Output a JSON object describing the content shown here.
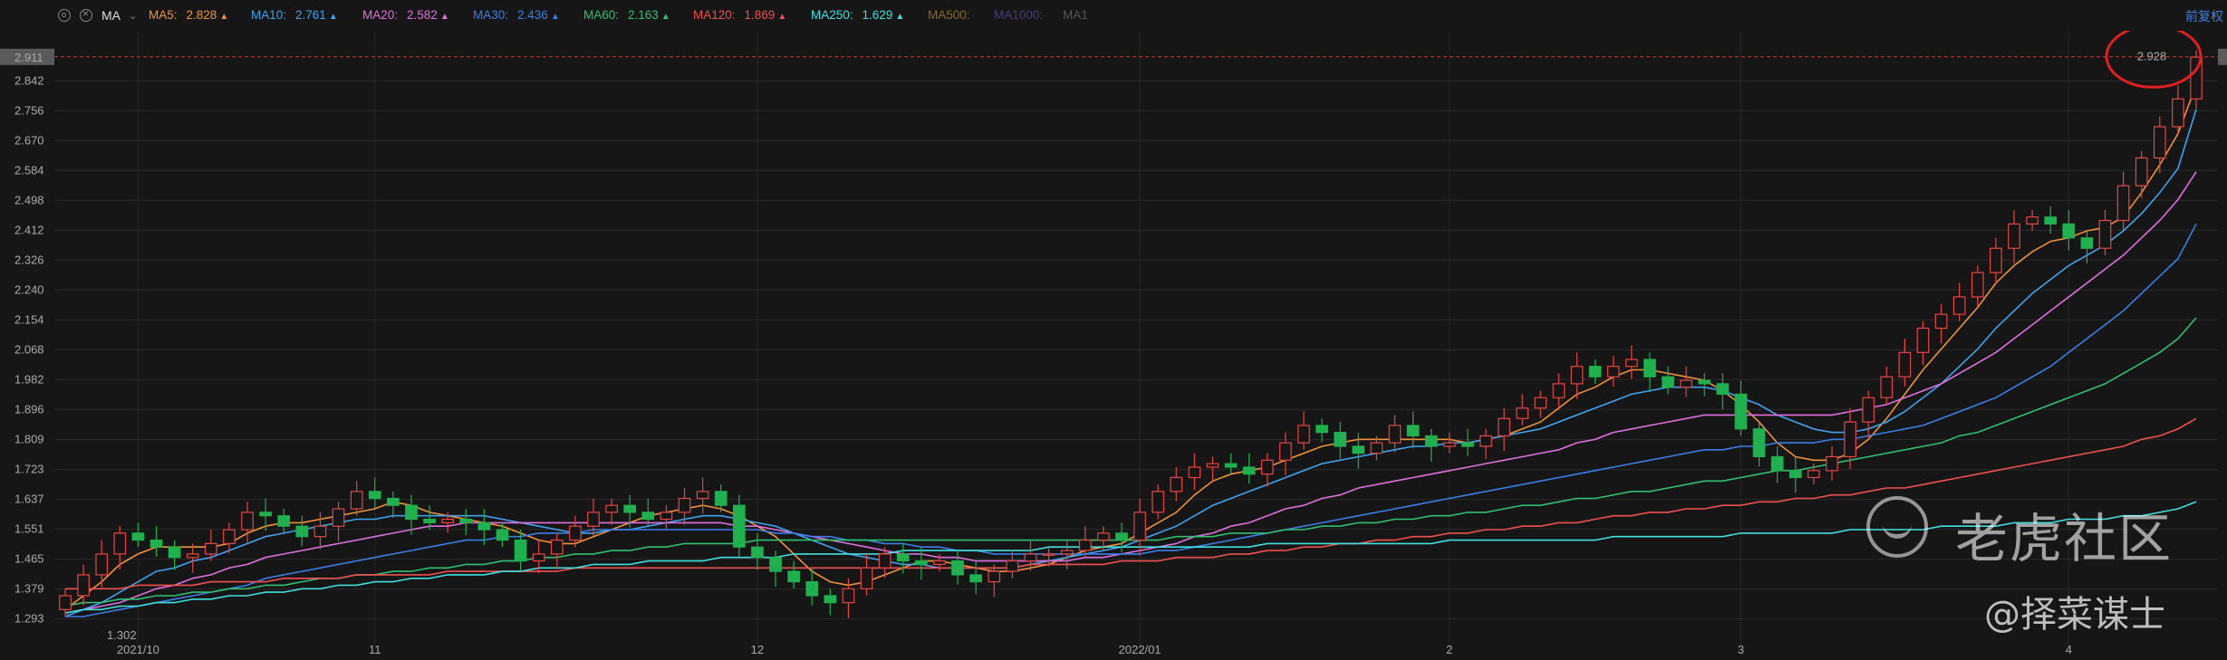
{
  "toolbar": {
    "indicator_label": "MA",
    "settings_icon": "gear-icon",
    "close_icon": "close-icon",
    "dropdown_icon": "chevron-down-icon",
    "adjust_label": "前复权"
  },
  "ma_legend": [
    {
      "label": "MA5:",
      "value": "2.828",
      "color": "#f0923a",
      "arrow": "▲"
    },
    {
      "label": "MA10:",
      "value": "2.761",
      "color": "#3fa3f0",
      "arrow": "▲"
    },
    {
      "label": "MA20:",
      "value": "2.582",
      "color": "#e070e0",
      "arrow": "▲"
    },
    {
      "label": "MA30:",
      "value": "2.436",
      "color": "#3a7fe8",
      "arrow": "▲"
    },
    {
      "label": "MA60:",
      "value": "2.163",
      "color": "#30c070",
      "arrow": "▲"
    },
    {
      "label": "MA120:",
      "value": "1.869",
      "color": "#f05050",
      "arrow": "▲"
    },
    {
      "label": "MA250:",
      "value": "1.629",
      "color": "#40e0e0",
      "arrow": "▲"
    },
    {
      "label": "MA500:",
      "value": "",
      "color": "#8a6a20",
      "arrow": ""
    },
    {
      "label": "MA1000:",
      "value": "",
      "color": "#4a3a7a",
      "arrow": ""
    },
    {
      "label": "MA1",
      "value": "",
      "color": "#555555",
      "arrow": ""
    }
  ],
  "watermark": {
    "brand_text": "老虎社区",
    "author_text": "@择菜谋士",
    "logo_icon": "tiger-logo-icon"
  },
  "chart_data": {
    "type": "candlestick",
    "y_ticks": [
      "2.842",
      "2.756",
      "2.670",
      "2.584",
      "2.498",
      "2.412",
      "2.326",
      "2.240",
      "2.154",
      "2.068",
      "1.982",
      "1.896",
      "1.809",
      "1.723",
      "1.637",
      "1.551",
      "1.465",
      "1.379",
      "1.293"
    ],
    "ylim": [
      1.24,
      2.96
    ],
    "x_labels": [
      {
        "label": "2021/10",
        "index": 4
      },
      {
        "label": "11",
        "index": 17
      },
      {
        "label": "12",
        "index": 38
      },
      {
        "label": "2022/01",
        "index": 59
      },
      {
        "label": "2",
        "index": 76
      },
      {
        "label": "3",
        "index": 92
      },
      {
        "label": "4",
        "index": 110
      }
    ],
    "current_price": "2.911",
    "high_label": "2.928",
    "low_label": "1.302",
    "candle_count": 118,
    "up_color": "#e84545",
    "down_color": "#1fb14e",
    "closes": [
      1.36,
      1.42,
      1.48,
      1.54,
      1.52,
      1.5,
      1.47,
      1.48,
      1.51,
      1.55,
      1.6,
      1.59,
      1.56,
      1.53,
      1.56,
      1.61,
      1.66,
      1.64,
      1.62,
      1.58,
      1.57,
      1.58,
      1.57,
      1.55,
      1.52,
      1.46,
      1.48,
      1.52,
      1.56,
      1.6,
      1.62,
      1.6,
      1.58,
      1.6,
      1.64,
      1.66,
      1.62,
      1.5,
      1.47,
      1.43,
      1.4,
      1.36,
      1.34,
      1.38,
      1.44,
      1.48,
      1.46,
      1.45,
      1.46,
      1.42,
      1.4,
      1.43,
      1.46,
      1.48,
      1.48,
      1.49,
      1.52,
      1.54,
      1.52,
      1.6,
      1.66,
      1.7,
      1.73,
      1.74,
      1.73,
      1.71,
      1.75,
      1.8,
      1.85,
      1.83,
      1.79,
      1.77,
      1.8,
      1.85,
      1.82,
      1.79,
      1.8,
      1.79,
      1.82,
      1.87,
      1.9,
      1.93,
      1.97,
      2.02,
      1.99,
      2.02,
      2.04,
      1.99,
      1.96,
      1.98,
      1.97,
      1.94,
      1.84,
      1.76,
      1.72,
      1.7,
      1.72,
      1.76,
      1.86,
      1.93,
      1.99,
      2.06,
      2.13,
      2.17,
      2.22,
      2.29,
      2.36,
      2.43,
      2.45,
      2.43,
      2.39,
      2.36,
      2.44,
      2.54,
      2.62,
      2.71,
      2.79,
      2.91
    ],
    "ma_series": {
      "MA5": [
        1.32,
        1.36,
        1.4,
        1.45,
        1.48,
        1.5,
        1.5,
        1.5,
        1.5,
        1.51,
        1.54,
        1.56,
        1.57,
        1.57,
        1.58,
        1.59,
        1.6,
        1.61,
        1.63,
        1.62,
        1.6,
        1.59,
        1.58,
        1.57,
        1.56,
        1.54,
        1.52,
        1.51,
        1.51,
        1.53,
        1.55,
        1.57,
        1.59,
        1.6,
        1.61,
        1.62,
        1.61,
        1.59,
        1.56,
        1.53,
        1.48,
        1.43,
        1.4,
        1.39,
        1.4,
        1.42,
        1.44,
        1.46,
        1.46,
        1.45,
        1.44,
        1.43,
        1.43,
        1.44,
        1.45,
        1.47,
        1.49,
        1.5,
        1.51,
        1.54,
        1.57,
        1.6,
        1.65,
        1.69,
        1.71,
        1.72,
        1.73,
        1.75,
        1.77,
        1.79,
        1.8,
        1.81,
        1.81,
        1.81,
        1.81,
        1.81,
        1.81,
        1.8,
        1.81,
        1.82,
        1.84,
        1.86,
        1.9,
        1.94,
        1.96,
        1.99,
        2.01,
        2.01,
        2.0,
        1.99,
        1.98,
        1.95,
        1.91,
        1.86,
        1.8,
        1.76,
        1.75,
        1.75,
        1.77,
        1.81,
        1.87,
        1.94,
        2.01,
        2.07,
        2.13,
        2.19,
        2.26,
        2.31,
        2.35,
        2.38,
        2.39,
        2.41,
        2.42,
        2.45,
        2.52,
        2.6,
        2.69,
        2.83
      ],
      "MA10": [
        1.3,
        1.32,
        1.34,
        1.37,
        1.4,
        1.43,
        1.44,
        1.46,
        1.47,
        1.49,
        1.51,
        1.53,
        1.54,
        1.55,
        1.56,
        1.57,
        1.58,
        1.58,
        1.59,
        1.59,
        1.59,
        1.59,
        1.59,
        1.59,
        1.58,
        1.57,
        1.56,
        1.55,
        1.54,
        1.54,
        1.55,
        1.55,
        1.56,
        1.57,
        1.58,
        1.59,
        1.59,
        1.58,
        1.57,
        1.56,
        1.54,
        1.52,
        1.5,
        1.48,
        1.47,
        1.46,
        1.45,
        1.45,
        1.44,
        1.44,
        1.44,
        1.44,
        1.44,
        1.45,
        1.46,
        1.47,
        1.48,
        1.49,
        1.5,
        1.52,
        1.54,
        1.56,
        1.59,
        1.62,
        1.64,
        1.66,
        1.68,
        1.7,
        1.72,
        1.74,
        1.75,
        1.76,
        1.77,
        1.78,
        1.79,
        1.79,
        1.8,
        1.8,
        1.81,
        1.82,
        1.83,
        1.84,
        1.86,
        1.88,
        1.9,
        1.92,
        1.94,
        1.95,
        1.96,
        1.96,
        1.96,
        1.95,
        1.93,
        1.91,
        1.88,
        1.86,
        1.84,
        1.83,
        1.83,
        1.84,
        1.86,
        1.89,
        1.93,
        1.97,
        2.02,
        2.07,
        2.13,
        2.18,
        2.23,
        2.27,
        2.31,
        2.34,
        2.37,
        2.41,
        2.46,
        2.52,
        2.59,
        2.76
      ],
      "MA20": [
        1.31,
        1.32,
        1.33,
        1.34,
        1.36,
        1.38,
        1.39,
        1.41,
        1.42,
        1.44,
        1.45,
        1.47,
        1.48,
        1.49,
        1.5,
        1.51,
        1.52,
        1.53,
        1.54,
        1.55,
        1.56,
        1.56,
        1.57,
        1.57,
        1.57,
        1.57,
        1.57,
        1.57,
        1.57,
        1.57,
        1.57,
        1.57,
        1.57,
        1.57,
        1.57,
        1.57,
        1.57,
        1.56,
        1.56,
        1.55,
        1.54,
        1.53,
        1.52,
        1.51,
        1.5,
        1.49,
        1.48,
        1.48,
        1.47,
        1.47,
        1.46,
        1.46,
        1.46,
        1.46,
        1.46,
        1.46,
        1.47,
        1.47,
        1.48,
        1.49,
        1.5,
        1.51,
        1.53,
        1.54,
        1.56,
        1.57,
        1.59,
        1.61,
        1.62,
        1.64,
        1.65,
        1.67,
        1.68,
        1.69,
        1.7,
        1.71,
        1.72,
        1.73,
        1.74,
        1.75,
        1.76,
        1.77,
        1.78,
        1.8,
        1.81,
        1.83,
        1.84,
        1.85,
        1.86,
        1.87,
        1.88,
        1.88,
        1.88,
        1.88,
        1.88,
        1.88,
        1.88,
        1.88,
        1.89,
        1.9,
        1.91,
        1.93,
        1.95,
        1.97,
        2.0,
        2.03,
        2.06,
        2.1,
        2.14,
        2.18,
        2.22,
        2.26,
        2.3,
        2.34,
        2.39,
        2.44,
        2.5,
        2.58
      ],
      "MA30": [
        1.3,
        1.3,
        1.31,
        1.32,
        1.33,
        1.34,
        1.35,
        1.36,
        1.37,
        1.38,
        1.39,
        1.41,
        1.42,
        1.43,
        1.44,
        1.45,
        1.46,
        1.47,
        1.48,
        1.49,
        1.5,
        1.51,
        1.52,
        1.52,
        1.53,
        1.53,
        1.54,
        1.54,
        1.54,
        1.55,
        1.55,
        1.55,
        1.55,
        1.55,
        1.55,
        1.55,
        1.55,
        1.55,
        1.55,
        1.54,
        1.54,
        1.53,
        1.53,
        1.52,
        1.52,
        1.51,
        1.51,
        1.5,
        1.5,
        1.49,
        1.49,
        1.48,
        1.48,
        1.48,
        1.48,
        1.48,
        1.48,
        1.48,
        1.48,
        1.48,
        1.49,
        1.49,
        1.5,
        1.51,
        1.52,
        1.53,
        1.54,
        1.55,
        1.56,
        1.57,
        1.58,
        1.59,
        1.6,
        1.61,
        1.62,
        1.63,
        1.64,
        1.65,
        1.66,
        1.67,
        1.68,
        1.69,
        1.7,
        1.71,
        1.72,
        1.73,
        1.74,
        1.75,
        1.76,
        1.77,
        1.78,
        1.78,
        1.79,
        1.79,
        1.8,
        1.8,
        1.8,
        1.81,
        1.81,
        1.82,
        1.83,
        1.84,
        1.85,
        1.87,
        1.89,
        1.91,
        1.93,
        1.96,
        1.99,
        2.02,
        2.06,
        2.1,
        2.14,
        2.18,
        2.23,
        2.28,
        2.33,
        2.43
      ],
      "MA60": [
        1.33,
        1.34,
        1.34,
        1.35,
        1.35,
        1.36,
        1.36,
        1.37,
        1.37,
        1.38,
        1.38,
        1.39,
        1.39,
        1.4,
        1.41,
        1.41,
        1.42,
        1.42,
        1.43,
        1.43,
        1.44,
        1.44,
        1.45,
        1.45,
        1.46,
        1.46,
        1.47,
        1.47,
        1.48,
        1.48,
        1.49,
        1.49,
        1.5,
        1.5,
        1.51,
        1.51,
        1.51,
        1.51,
        1.52,
        1.52,
        1.52,
        1.52,
        1.52,
        1.52,
        1.52,
        1.52,
        1.52,
        1.52,
        1.52,
        1.52,
        1.52,
        1.52,
        1.52,
        1.52,
        1.52,
        1.52,
        1.52,
        1.52,
        1.52,
        1.52,
        1.52,
        1.53,
        1.53,
        1.53,
        1.54,
        1.54,
        1.54,
        1.55,
        1.55,
        1.56,
        1.56,
        1.57,
        1.57,
        1.58,
        1.58,
        1.59,
        1.59,
        1.6,
        1.6,
        1.61,
        1.62,
        1.62,
        1.63,
        1.64,
        1.64,
        1.65,
        1.66,
        1.66,
        1.67,
        1.68,
        1.69,
        1.69,
        1.7,
        1.71,
        1.72,
        1.72,
        1.73,
        1.74,
        1.75,
        1.76,
        1.77,
        1.78,
        1.79,
        1.8,
        1.82,
        1.83,
        1.85,
        1.87,
        1.89,
        1.91,
        1.93,
        1.95,
        1.97,
        2.0,
        2.03,
        2.06,
        2.1,
        2.16
      ],
      "MA120": [
        1.38,
        1.38,
        1.38,
        1.38,
        1.39,
        1.39,
        1.39,
        1.39,
        1.4,
        1.4,
        1.4,
        1.4,
        1.41,
        1.41,
        1.41,
        1.41,
        1.42,
        1.42,
        1.42,
        1.42,
        1.42,
        1.43,
        1.43,
        1.43,
        1.43,
        1.43,
        1.43,
        1.43,
        1.44,
        1.44,
        1.44,
        1.44,
        1.44,
        1.44,
        1.44,
        1.44,
        1.44,
        1.44,
        1.44,
        1.44,
        1.44,
        1.44,
        1.44,
        1.44,
        1.44,
        1.44,
        1.44,
        1.44,
        1.44,
        1.44,
        1.44,
        1.44,
        1.44,
        1.45,
        1.45,
        1.45,
        1.45,
        1.45,
        1.46,
        1.46,
        1.46,
        1.47,
        1.47,
        1.47,
        1.48,
        1.48,
        1.49,
        1.49,
        1.5,
        1.5,
        1.51,
        1.51,
        1.52,
        1.52,
        1.53,
        1.53,
        1.54,
        1.54,
        1.55,
        1.55,
        1.56,
        1.56,
        1.57,
        1.57,
        1.58,
        1.59,
        1.59,
        1.6,
        1.6,
        1.61,
        1.61,
        1.62,
        1.62,
        1.63,
        1.63,
        1.64,
        1.64,
        1.65,
        1.65,
        1.66,
        1.67,
        1.67,
        1.68,
        1.69,
        1.7,
        1.71,
        1.72,
        1.73,
        1.74,
        1.75,
        1.76,
        1.77,
        1.78,
        1.79,
        1.81,
        1.82,
        1.84,
        1.87
      ],
      "MA250": [
        1.31,
        1.32,
        1.32,
        1.33,
        1.33,
        1.34,
        1.34,
        1.35,
        1.35,
        1.36,
        1.36,
        1.37,
        1.37,
        1.38,
        1.38,
        1.39,
        1.39,
        1.4,
        1.4,
        1.41,
        1.41,
        1.42,
        1.42,
        1.42,
        1.43,
        1.43,
        1.44,
        1.44,
        1.44,
        1.45,
        1.45,
        1.45,
        1.46,
        1.46,
        1.46,
        1.46,
        1.47,
        1.47,
        1.47,
        1.47,
        1.48,
        1.48,
        1.48,
        1.48,
        1.48,
        1.48,
        1.49,
        1.49,
        1.49,
        1.49,
        1.49,
        1.49,
        1.49,
        1.49,
        1.5,
        1.5,
        1.5,
        1.5,
        1.5,
        1.5,
        1.5,
        1.5,
        1.5,
        1.5,
        1.5,
        1.5,
        1.51,
        1.51,
        1.51,
        1.51,
        1.51,
        1.51,
        1.51,
        1.51,
        1.51,
        1.51,
        1.52,
        1.52,
        1.52,
        1.52,
        1.52,
        1.52,
        1.52,
        1.52,
        1.52,
        1.53,
        1.53,
        1.53,
        1.53,
        1.53,
        1.53,
        1.53,
        1.54,
        1.54,
        1.54,
        1.54,
        1.54,
        1.54,
        1.55,
        1.55,
        1.55,
        1.55,
        1.55,
        1.56,
        1.56,
        1.56,
        1.56,
        1.57,
        1.57,
        1.57,
        1.58,
        1.58,
        1.58,
        1.59,
        1.59,
        1.6,
        1.61,
        1.63
      ]
    }
  }
}
